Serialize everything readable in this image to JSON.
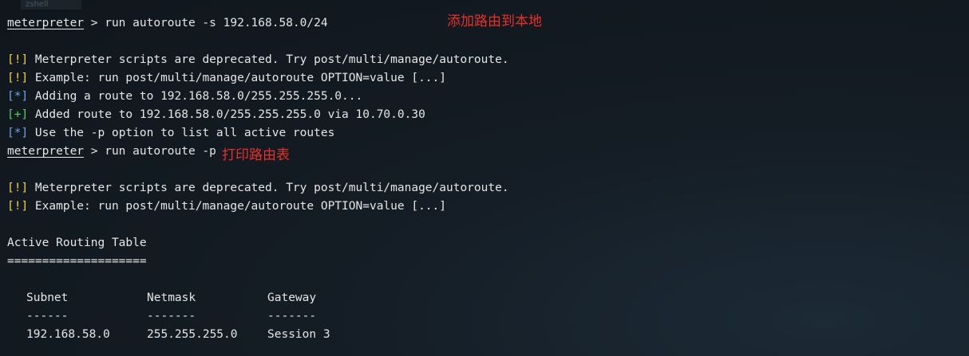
{
  "window": {
    "tab_title": "zshell"
  },
  "annotations": {
    "add_route": "添加路由到本地",
    "print_table": "打印路由表"
  },
  "lines": {
    "l1_prompt": "meterpreter",
    "l1_cmd": " > run autoroute -s 192.168.58.0/24",
    "l3_tag": "[!]",
    "l3_text": " Meterpreter scripts are deprecated. Try post/multi/manage/autoroute.",
    "l4_tag": "[!]",
    "l4_text": " Example: run post/multi/manage/autoroute OPTION=value [...]",
    "l5_tag": "[*]",
    "l5_text": " Adding a route to 192.168.58.0/255.255.255.0...",
    "l6_tag": "[+]",
    "l6_text": " Added route to 192.168.58.0/255.255.255.0 via 10.70.0.30",
    "l7_tag": "[*]",
    "l7_text": " Use the -p option to list all active routes",
    "l8_prompt": "meterpreter",
    "l8_cmd": " > run autoroute -p",
    "l10_tag": "[!]",
    "l10_text": " Meterpreter scripts are deprecated. Try post/multi/manage/autoroute.",
    "l11_tag": "[!]",
    "l11_text": " Example: run post/multi/manage/autoroute OPTION=value [...]",
    "table_title": "Active Routing Table",
    "table_rule": "===================="
  },
  "routing_table": {
    "headers": [
      "Subnet",
      "Netmask",
      "Gateway"
    ],
    "separators": [
      "------",
      "-------",
      "-------"
    ],
    "rows": [
      [
        "192.168.58.0",
        "255.255.255.0",
        "Session 3"
      ]
    ]
  },
  "colors": {
    "warning": "#f2d24b",
    "info": "#6fa3e8",
    "success": "#57d068",
    "annotation": "#e8312b"
  }
}
